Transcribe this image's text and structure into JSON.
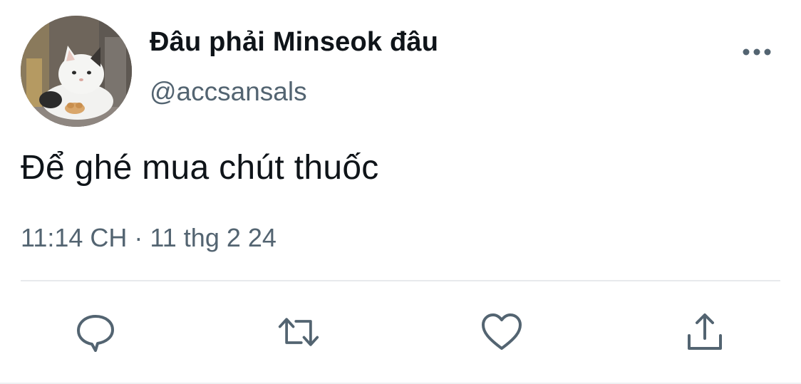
{
  "tweet": {
    "display_name": "Đâu phải Minseok đâu",
    "handle": "@accsansals",
    "text": "Để ghé mua chút thuốc",
    "time": "11:14 CH",
    "separator": "·",
    "date": "11 thg 2 24"
  },
  "icons": {
    "more": "more-horizontal-icon",
    "reply": "reply-bubble-icon",
    "retweet": "retweet-icon",
    "like": "heart-icon",
    "share": "share-upload-icon"
  },
  "colors": {
    "text_primary": "#0f1419",
    "text_secondary": "#536471",
    "icon": "#536471",
    "divider": "#e7e9ec"
  }
}
